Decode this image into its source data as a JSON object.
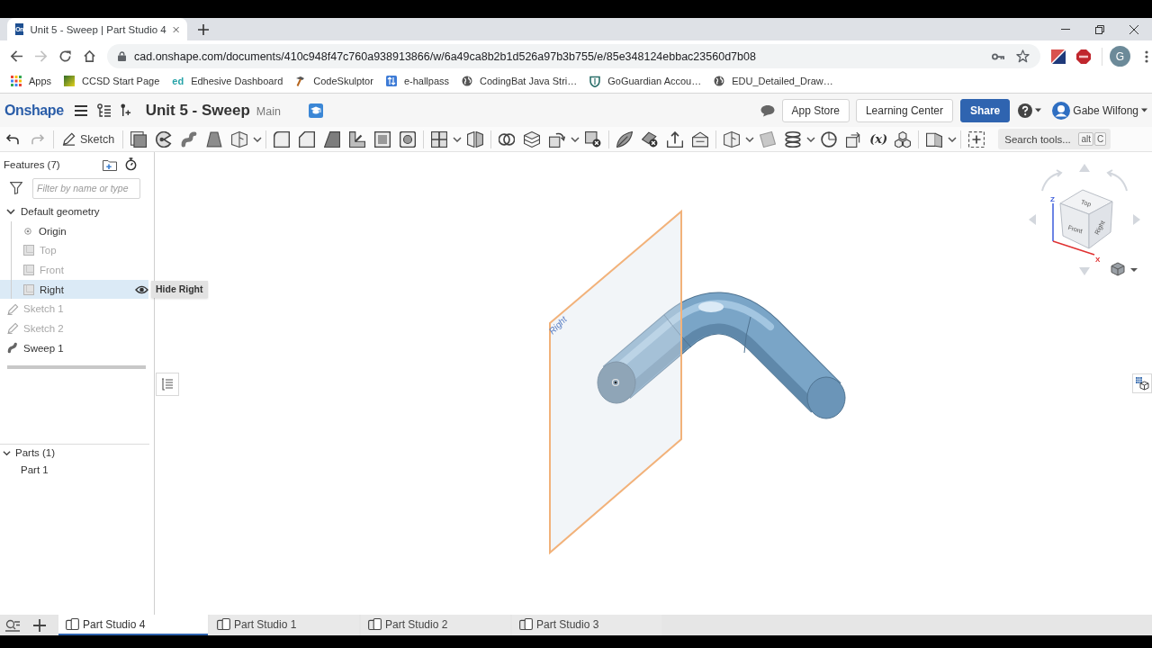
{
  "browser": {
    "tabs": [
      {
        "favicon": "On",
        "title": "Unit 5 - Sweep | Part Studio 4",
        "selected": true
      }
    ],
    "can_go_forward": false,
    "url": "cad.onshape.com/documents/410c948f47c760a938913866/w/6a49ca8b2b1d526a97b3b755/e/85e348124ebbac23560d7b08",
    "bookmarks": [
      {
        "kind": "apps",
        "label": "Apps"
      },
      {
        "kind": "gradient",
        "label": "CCSD Start Page"
      },
      {
        "kind": "badge",
        "badge": "ed",
        "label": "Edhesive Dashboard"
      },
      {
        "kind": "hammer",
        "label": "CodeSkulptor"
      },
      {
        "kind": "arrows",
        "label": "e-hallpass"
      },
      {
        "kind": "globe",
        "label": "CodingBat Java Stri…"
      },
      {
        "kind": "shield",
        "label": "GoGuardian Accou…"
      },
      {
        "kind": "globe",
        "label": "EDU_Detailed_Draw…"
      }
    ],
    "profile_initial": "G"
  },
  "app": {
    "logo": "Onshape",
    "document": "Unit 5 - Sweep",
    "branch": "Main",
    "buttons": [
      {
        "kind": "plain",
        "label": "App Store"
      },
      {
        "kind": "plain",
        "label": "Learning Center"
      },
      {
        "kind": "primary",
        "label": "Share"
      }
    ],
    "user": "Gabe Wilfong"
  },
  "toolbar": {
    "sketch": "Sketch",
    "variable": "(x)",
    "search": {
      "placeholder": "Search tools...",
      "keys": [
        "alt",
        "C"
      ]
    }
  },
  "features": {
    "title": "Features (7)",
    "filter_placeholder": "Filter by name or type",
    "tree": [
      {
        "kind": "group",
        "label": "Default geometry",
        "expanded": true,
        "highlighted": false,
        "children": [
          {
            "kind": "origin",
            "label": "Origin",
            "hidden": false,
            "highlighted": false
          },
          {
            "kind": "plane",
            "label": "Top",
            "hidden": true,
            "highlighted": false
          },
          {
            "kind": "plane",
            "label": "Front",
            "hidden": true,
            "highlighted": false
          },
          {
            "kind": "plane",
            "label": "Right",
            "hidden": false,
            "highlighted": true,
            "tooltip": "Hide Right"
          }
        ]
      },
      {
        "kind": "sketch",
        "label": "Sketch 1",
        "hidden": true,
        "highlighted": false
      },
      {
        "kind": "sketch",
        "label": "Sketch 2",
        "hidden": true,
        "highlighted": false
      },
      {
        "kind": "sweep",
        "label": "Sweep 1",
        "hidden": false,
        "highlighted": false
      }
    ]
  },
  "parts": {
    "title": "Parts (1)",
    "expanded": true,
    "items": [
      "Part 1"
    ]
  },
  "viewport": {
    "plane_label": "Right",
    "view_cube": {
      "faces": [
        "Top",
        "Front",
        "Right"
      ],
      "axes": [
        "Z",
        "X"
      ]
    }
  },
  "document_tabs": [
    {
      "label": "Part Studio 4",
      "selected": true
    },
    {
      "label": "Part Studio 1",
      "selected": false
    },
    {
      "label": "Part Studio 2",
      "selected": false
    },
    {
      "label": "Part Studio 3",
      "selected": false
    }
  ]
}
